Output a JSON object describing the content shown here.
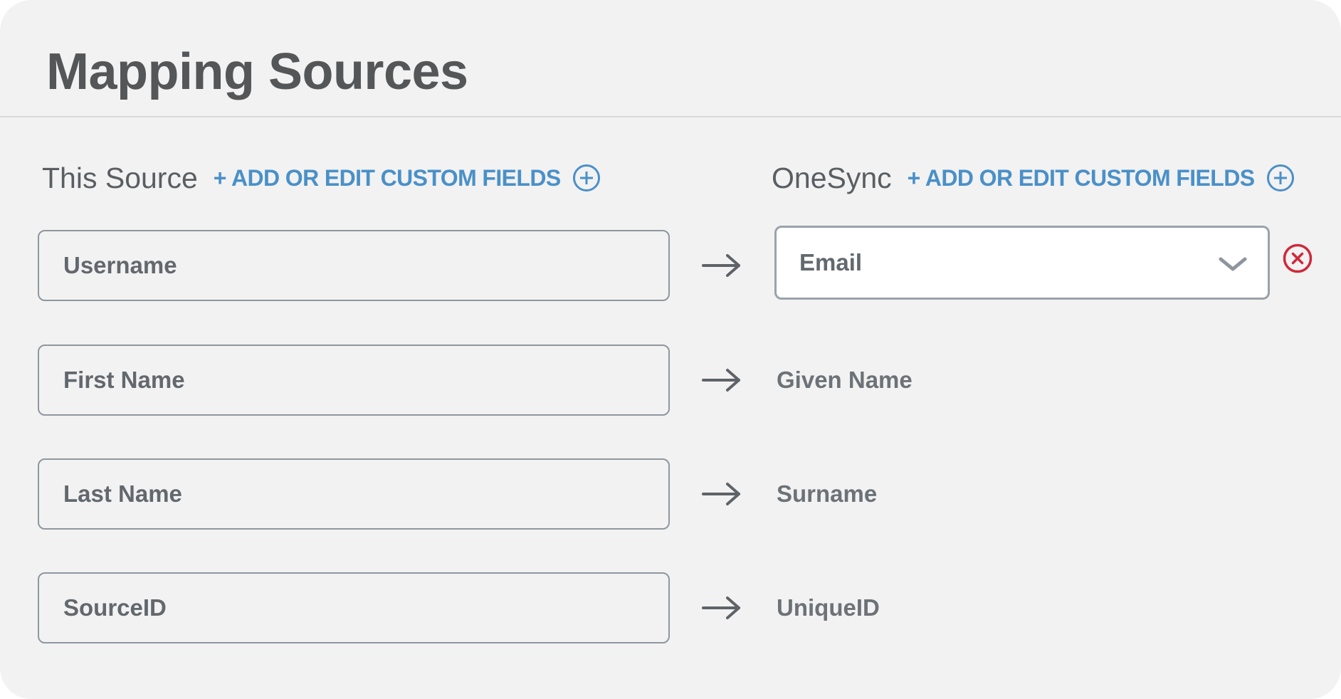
{
  "page": {
    "title": "Mapping Sources"
  },
  "source_column": {
    "title": "This Source",
    "add_link": "+ ADD OR EDIT CUSTOM FIELDS",
    "add_icon": "plus-circle-icon"
  },
  "target_column": {
    "title": "OneSync",
    "add_link": "+ ADD OR EDIT CUSTOM FIELDS",
    "add_icon": "plus-circle-icon"
  },
  "mappings": [
    {
      "source": "Username",
      "target": "Email",
      "target_is_select": true
    },
    {
      "source": "First Name",
      "target": "Given Name",
      "target_is_select": false
    },
    {
      "source": "Last Name",
      "target": "Surname",
      "target_is_select": false
    },
    {
      "source": "SourceID",
      "target": "UniqueID",
      "target_is_select": false
    }
  ],
  "icons": {
    "arrow": "arrow-right-icon",
    "dropdown": "chevron-down-icon",
    "remove": "close-circle-icon"
  },
  "colors": {
    "accent": "#4a90c8",
    "danger": "#d0283a",
    "panel_background": "#f2f2f2",
    "title_text": "#545658"
  }
}
